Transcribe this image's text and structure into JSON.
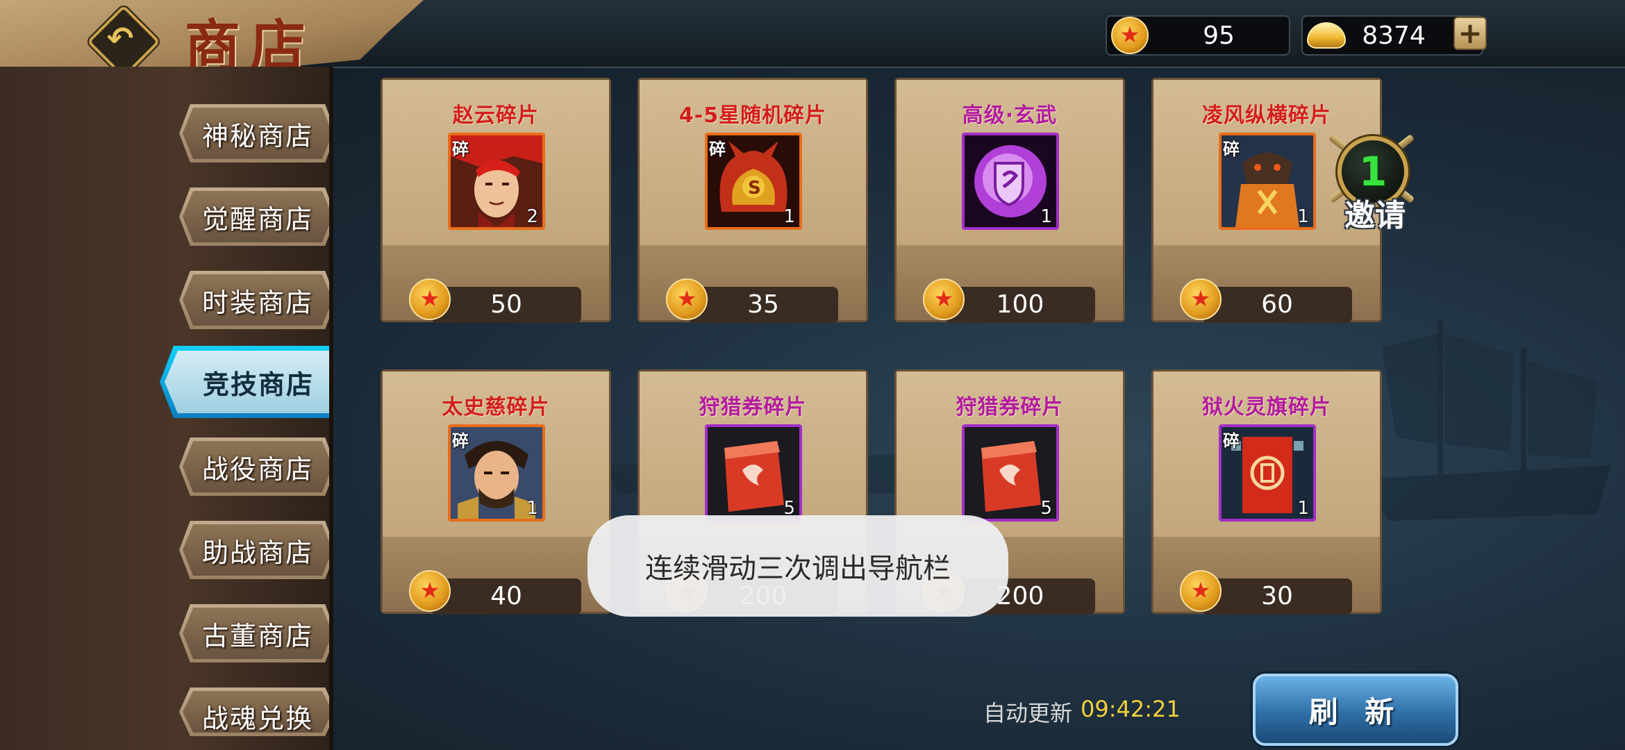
{
  "header": {
    "title": "商店",
    "currency_arena": "95",
    "currency_gold": "8374"
  },
  "sidebar": {
    "tabs": [
      {
        "label": "神秘商店",
        "active": false
      },
      {
        "label": "觉醒商店",
        "active": false
      },
      {
        "label": "时装商店",
        "active": false
      },
      {
        "label": "竞技商店",
        "active": true
      },
      {
        "label": "战役商店",
        "active": false
      },
      {
        "label": "助战商店",
        "active": false
      },
      {
        "label": "古董商店",
        "active": false
      },
      {
        "label": "战魂兑换",
        "active": false
      }
    ]
  },
  "items": [
    {
      "name": "赵云碎片",
      "qty": "2",
      "price": "50",
      "fragment_tag": "碎",
      "icon": "zhao-yun-portrait-icon"
    },
    {
      "name": "4-5星随机碎片",
      "qty": "1",
      "price": "35",
      "fragment_tag": "碎",
      "icon": "random-helmet-icon"
    },
    {
      "name": "高级·玄武",
      "qty": "1",
      "price": "100",
      "fragment_tag": "",
      "icon": "xuanwu-shield-icon"
    },
    {
      "name": "凌风纵横碎片",
      "qty": "1",
      "price": "60",
      "fragment_tag": "碎",
      "icon": "lingfeng-armor-icon"
    },
    {
      "name": "太史慈碎片",
      "qty": "1",
      "price": "40",
      "fragment_tag": "碎",
      "icon": "taishi-ci-portrait-icon"
    },
    {
      "name": "狩猎券碎片",
      "qty": "5",
      "price": "200",
      "fragment_tag": "",
      "icon": "hunting-ticket-icon"
    },
    {
      "name": "狩猎券碎片",
      "qty": "5",
      "price": "200",
      "fragment_tag": "",
      "icon": "hunting-ticket-icon"
    },
    {
      "name": "狱火灵旗碎片",
      "qty": "1",
      "price": "30",
      "fragment_tag": "碎",
      "icon": "hellfire-banner-icon"
    }
  ],
  "invite": {
    "count": "1",
    "label": "邀请"
  },
  "toast": "连续滑动三次调出导航栏",
  "footer": {
    "auto_refresh_label": "自动更新",
    "auto_refresh_time": "09:42:21",
    "refresh_button": "刷 新"
  },
  "colors": {
    "item_name_red": "#d31d1d",
    "item_name_purple": "#b21a9f",
    "active_tab": "#0fd0ff",
    "timer": "#f2d23a"
  }
}
